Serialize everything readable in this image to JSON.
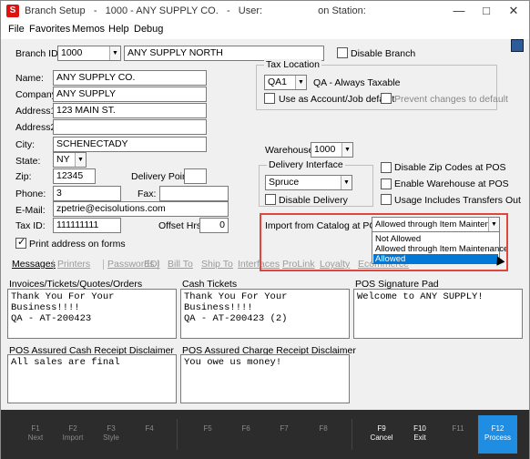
{
  "window": {
    "title": "Branch Setup   -   1000 - ANY SUPPLY CO.   -   User:                    on Station:",
    "app_icon": "S",
    "controls": [
      "minimize-icon",
      "maximize-icon",
      "close-icon"
    ]
  },
  "menu": [
    "File",
    "Favorites",
    "Memos",
    "Help",
    "Debug"
  ],
  "branch": {
    "id_label": "Branch ID:",
    "id_value": "1000",
    "name_value": "ANY SUPPLY NORTH",
    "disable_label": "Disable Branch"
  },
  "address": {
    "name_label": "Name:",
    "name_value": "ANY SUPPLY CO.",
    "company_label": "Company:",
    "company_value": "ANY SUPPLY",
    "address1_label": "Address1:",
    "address1_value": "123 MAIN ST.",
    "address2_label": "Address2:",
    "address2_value": "",
    "city_label": "City:",
    "city_value": "SCHENECTADY",
    "state_label": "State:",
    "state_value": "NY",
    "zip_label": "Zip:",
    "zip_value": "12345",
    "delivery_point_label": "Delivery Point:",
    "delivery_point_value": "",
    "phone_label": "Phone:",
    "phone_value": "3",
    "fax_label": "Fax:",
    "fax_value": "",
    "email_label": "E-Mail:",
    "email_value": "zpetrie@ecisolutions.com",
    "taxid_label": "Tax ID:",
    "taxid_value": "111111111",
    "offset_label": "Offset Hrs:",
    "offset_value": "0",
    "print_address_label": "Print address on forms"
  },
  "tax": {
    "group_title": "Tax Location",
    "location_value": "QA1",
    "location_desc": "QA - Always Taxable",
    "use_account_label": "Use as Account/Job default",
    "prevent_label": "Prevent changes to default"
  },
  "warehouse": {
    "label": "Warehouse:",
    "value": "1000"
  },
  "delivery": {
    "group_title": "Delivery Interface",
    "value": "Spruce",
    "disable_label": "Disable Delivery"
  },
  "pos_options": {
    "disable_zip": "Disable Zip Codes at POS",
    "enable_warehouse": "Enable Warehouse at POS",
    "usage_transfers": "Usage Includes Transfers Out"
  },
  "import_catalog": {
    "label": "Import from Catalog at POS:",
    "value": "Allowed through Item Maintenance",
    "options": [
      "Not Allowed",
      "Allowed through Item Maintenance",
      "Allowed"
    ],
    "highlighted": "Allowed"
  },
  "tabs": [
    "Messages",
    "Printers",
    "Passwords",
    "EDI",
    "Bill To",
    "Ship To",
    "Interfaces",
    "ProLink",
    "Loyalty",
    "Ecommerce"
  ],
  "messages": {
    "invoices_label": "Invoices/Tickets/Quotes/Orders",
    "invoices_text": "Thank You For Your\nBusiness!!!!\nQA - AT-200423",
    "cash_label": "Cash Tickets",
    "cash_text": "Thank You For Your\nBusiness!!!!\nQA - AT-200423 (2)",
    "signature_label": "POS Signature Pad",
    "signature_text": "Welcome to ANY SUPPLY!",
    "cash_disclaimer_label": "POS Assured Cash Receipt Disclaimer",
    "cash_disclaimer_text": "All sales are final",
    "charge_disclaimer_label": "POS Assured Charge Receipt Disclaimer",
    "charge_disclaimer_text": "You owe us money!"
  },
  "fkeys": [
    {
      "key": "F1",
      "text": "Next"
    },
    {
      "key": "F2",
      "text": "Import"
    },
    {
      "key": "F3",
      "text": "Style"
    },
    {
      "key": "F4",
      "text": ""
    },
    {
      "key": "F5",
      "text": ""
    },
    {
      "key": "F6",
      "text": ""
    },
    {
      "key": "F7",
      "text": ""
    },
    {
      "key": "F8",
      "text": ""
    },
    {
      "key": "F9",
      "text": "Cancel"
    },
    {
      "key": "F10",
      "text": "Exit"
    },
    {
      "key": "F11",
      "text": ""
    },
    {
      "key": "F12",
      "text": "Process"
    }
  ],
  "colors": {
    "highlight_frame": "#e0463d",
    "selection": "#0078d7",
    "process_button": "#1f8de2",
    "fkey_bar": "#2c2c2c"
  }
}
